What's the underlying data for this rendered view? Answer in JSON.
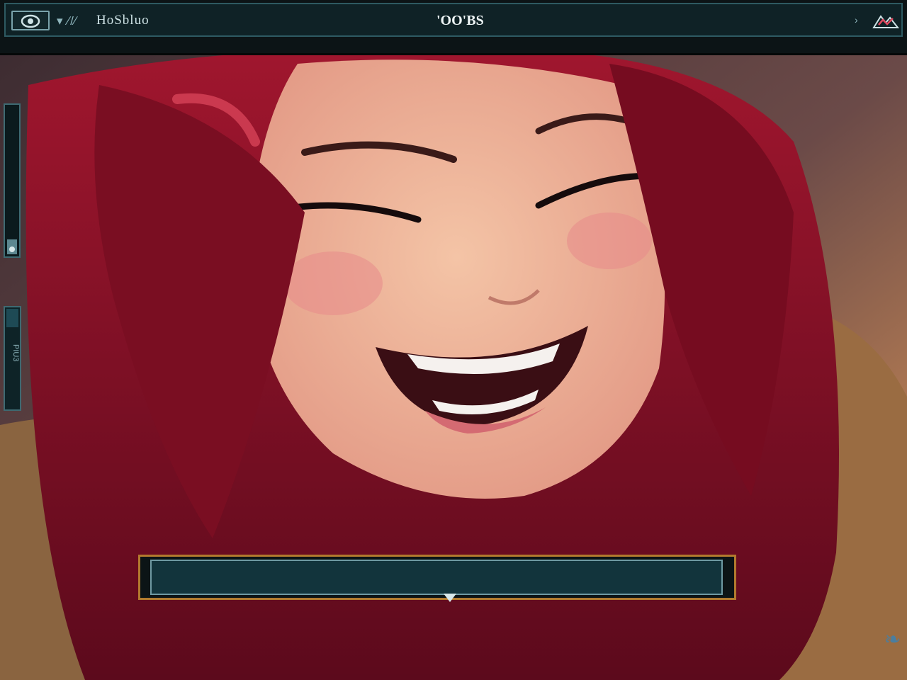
{
  "topbar": {
    "brand_prefix": "▾ ∕/∕",
    "brand_title": "HoSbluo",
    "center_title": "'OO'BS",
    "chevron": "›"
  },
  "side_panel": {
    "label": "PIU3"
  },
  "side_gauge": {
    "level_fraction": 0.1
  },
  "dialog": {
    "text": ""
  },
  "icons": {
    "eye": "eye-icon",
    "logo": "mountain-logo-icon",
    "corner": "glyph-icon"
  },
  "colors": {
    "frame_teal": "#2e5a62",
    "dialog_gold": "#b27a2e",
    "hair_crimson": "#8a0f24"
  }
}
